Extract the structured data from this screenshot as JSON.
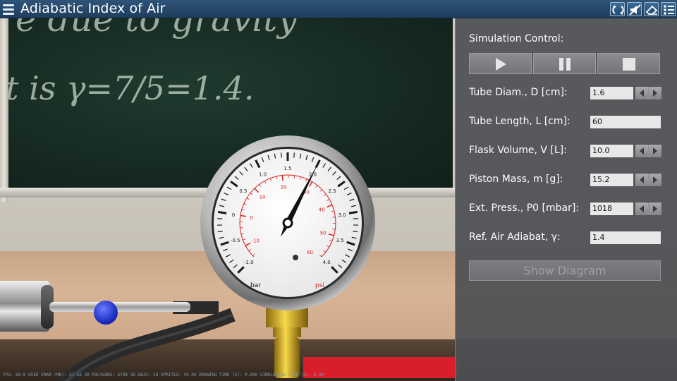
{
  "app": {
    "title": "Adiabatic Index of Air"
  },
  "toolbar": {
    "icons": [
      "menu-icon",
      "reset-icon",
      "mute-icon",
      "eraser-icon",
      "settings-list-icon"
    ]
  },
  "chalkboard": {
    "line1": "e due to gravity",
    "line2": "t is γ=7/5=1.4."
  },
  "gauge": {
    "bar_scale": [
      "-1.0",
      "-0.5",
      "0",
      "0.5",
      "1.0",
      "1.5",
      "2.0",
      "2.5",
      "3.0",
      "3.5",
      "4.0"
    ],
    "psi_scale": [
      "-10",
      "0",
      "10",
      "20",
      "30",
      "40",
      "50",
      "60"
    ],
    "unit_bar": "bar",
    "unit_psi": "psi",
    "needle_bar_value": 2.0,
    "colors": {
      "psi": "#d21f1f",
      "bar": "#1a1a1a"
    }
  },
  "panel": {
    "simulation_control_label": "Simulation Control:",
    "buttons": {
      "play": "play-icon",
      "pause": "pause-icon",
      "stop": "stop-icon"
    },
    "fields": [
      {
        "label": "Tube Diam., D [cm]:",
        "value": "1.6",
        "spinner": true
      },
      {
        "label": "Tube Length, L [cm]:",
        "value": "60",
        "spinner": false
      },
      {
        "label": "Flask Volume, V [L]:",
        "value": "10.0",
        "spinner": true
      },
      {
        "label": "Piston Mass, m [g]:",
        "value": "15.2",
        "spinner": true
      },
      {
        "label": "Ext. Press., P0 [mbar]:",
        "value": "1018",
        "spinner": true
      },
      {
        "label": "Ref. Air Adiabat, γ:",
        "value": "1.4",
        "spinner": false
      }
    ],
    "show_diagram_label": "Show Diagram"
  },
  "status": {
    "text": "FPS: 60.0  USED VRAM (MB): 47.66  3D POLYGONS: 6798  3D OBJS: 58  SPRITES: 45.00  DRAWING TIME (S): 0.000  SIMULATION TIME (S): 0.00"
  }
}
